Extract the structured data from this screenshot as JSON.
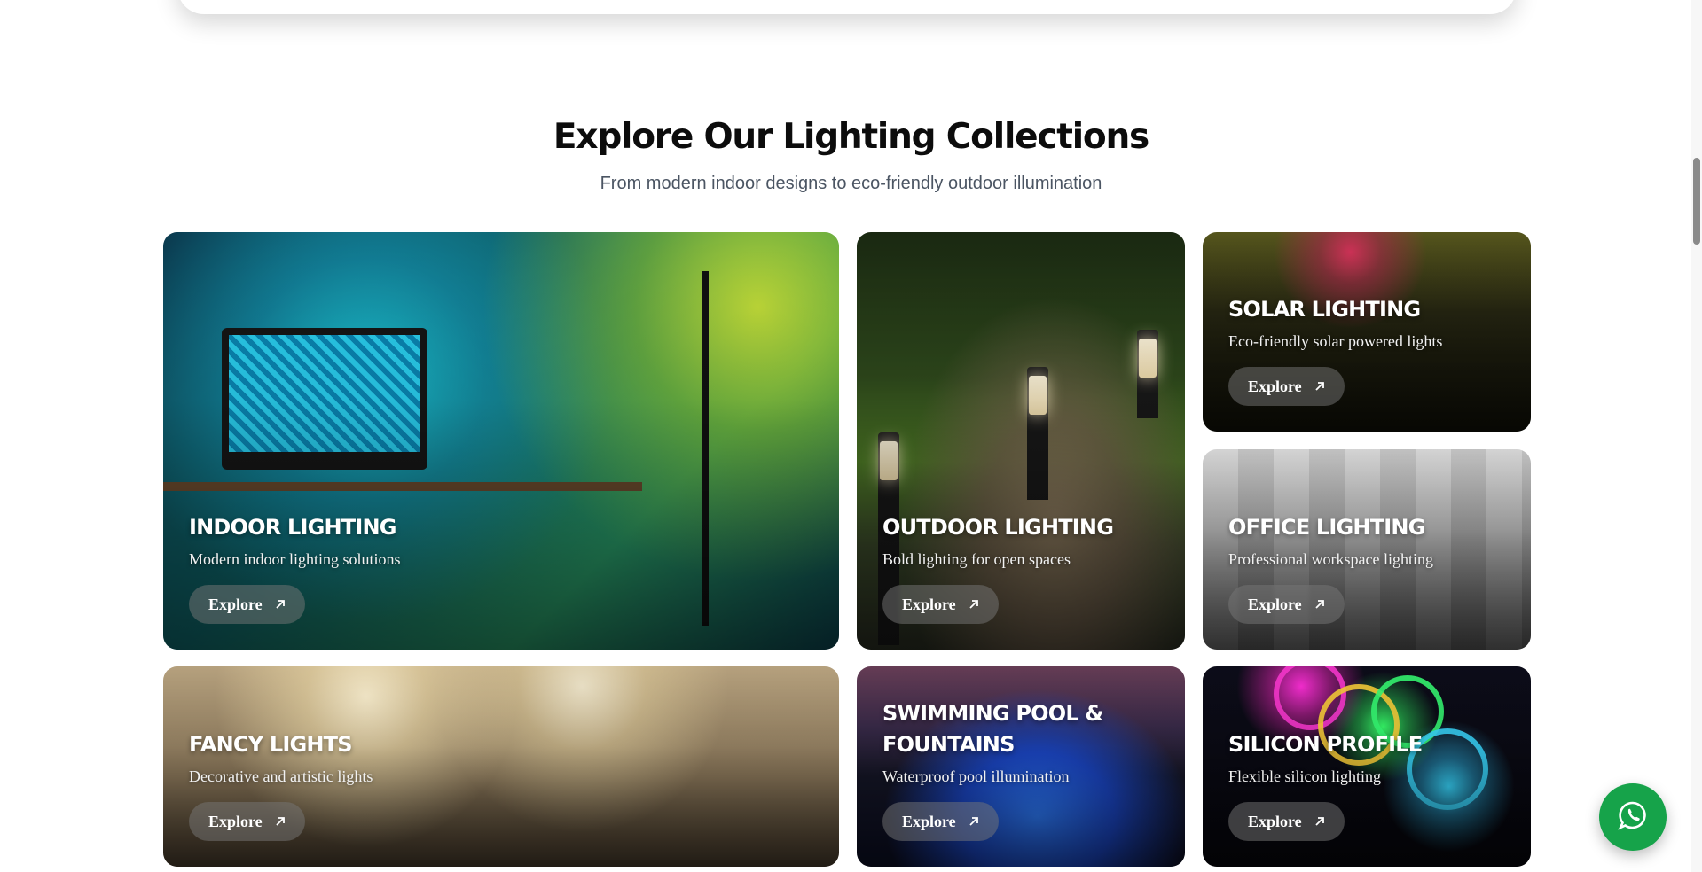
{
  "section": {
    "title": "Explore Our Lighting Collections",
    "subtitle": "From modern indoor designs to eco-friendly outdoor illumination"
  },
  "cards": [
    {
      "title": "INDOOR LIGHTING",
      "description": "Modern indoor lighting solutions",
      "button": "Explore"
    },
    {
      "title": "OUTDOOR LIGHTING",
      "description": "Bold lighting for open spaces",
      "button": "Explore"
    },
    {
      "title": "SOLAR LIGHTING",
      "description": "Eco-friendly solar powered lights",
      "button": "Explore"
    },
    {
      "title": "OFFICE LIGHTING",
      "description": "Professional workspace lighting",
      "button": "Explore"
    },
    {
      "title": "FANCY LIGHTS",
      "description": "Decorative and artistic lights",
      "button": "Explore"
    },
    {
      "title": "SWIMMING POOL & FOUNTAINS",
      "description": "Waterproof pool illumination",
      "button": "Explore"
    },
    {
      "title": "SILICON PROFILE",
      "description": "Flexible silicon lighting",
      "button": "Explore"
    }
  ],
  "icons": {
    "explore_arrow": "arrow-up-right-icon",
    "chat": "whatsapp-icon"
  },
  "colors": {
    "whatsapp": "#16a34a",
    "heading": "#0c0c0c",
    "subtitle": "#4b5563"
  }
}
